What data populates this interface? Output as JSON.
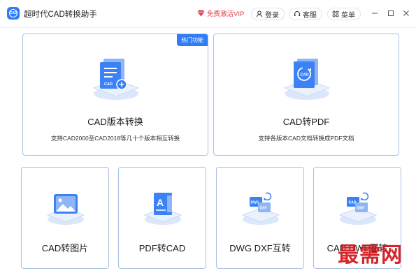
{
  "app": {
    "title": "超时代CAD转换助手"
  },
  "header": {
    "vip_label": "免费激活VIP",
    "login_label": "登录",
    "service_label": "客服",
    "menu_label": "菜单"
  },
  "features": {
    "cad_version": {
      "title": "CAD版本转换",
      "desc": "支持CAD2000至CAD2018等几十个版本相互转换",
      "badge": "热门功能"
    },
    "cad_pdf": {
      "title": "CAD转PDF",
      "desc": "支持各版本CAD文档转换成PDF文档"
    },
    "cad_image": {
      "title": "CAD转图片"
    },
    "pdf_cad": {
      "title": "PDF转CAD"
    },
    "dwg_dxf": {
      "title": "DWG DXF互转"
    },
    "cad_dwf": {
      "title": "CAD DWF互转"
    }
  },
  "icons": {
    "cad_version": "cad-file-plus-icon",
    "cad_pdf": "cad-circle-convert-icon",
    "cad_image": "picture-icon",
    "pdf_cad": "text-a-icon",
    "dwg_dxf": "dwg-dxf-swap-icon",
    "cad_dwf": "cad-dwf-swap-icon"
  },
  "colors": {
    "accent": "#2f7cf6",
    "vip": "#e0424e",
    "card_border": "#a7c1e4"
  },
  "watermark": "最需网"
}
